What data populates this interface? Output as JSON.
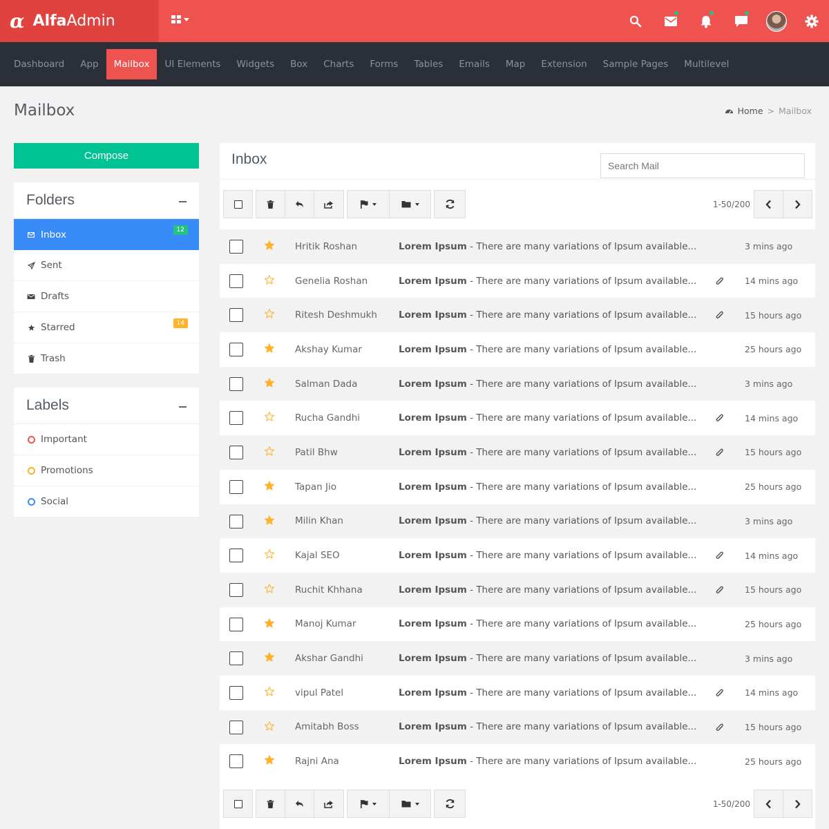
{
  "brand": {
    "part1": "Alfa",
    "part2": "Admin",
    "logo_icon": "alpha-logo"
  },
  "top_icons": [
    "search-icon",
    "mail-icon",
    "bell-icon",
    "chat-icon",
    "avatar",
    "gear-icon"
  ],
  "nav": [
    "Dashboard",
    "App",
    "Mailbox",
    "UI Elements",
    "Widgets",
    "Box",
    "Charts",
    "Forms",
    "Tables",
    "Emails",
    "Map",
    "Extension",
    "Sample Pages",
    "Multilevel"
  ],
  "nav_active": "Mailbox",
  "page": {
    "title": "Mailbox"
  },
  "breadcrumb": {
    "home": "Home",
    "sep": ">",
    "current": "Mailbox"
  },
  "compose": "Compose",
  "folders": {
    "title": "Folders",
    "items": [
      {
        "label": "Inbox",
        "icon": "envelope-icon",
        "badge": "12",
        "active": true
      },
      {
        "label": "Sent",
        "icon": "paper-plane-icon"
      },
      {
        "label": "Drafts",
        "icon": "drafts-icon"
      },
      {
        "label": "Starred",
        "icon": "star-icon",
        "badge": "14"
      },
      {
        "label": "Trash",
        "icon": "trash-icon"
      }
    ]
  },
  "labels": {
    "title": "Labels",
    "items": [
      {
        "label": "Important",
        "color": "#ef5350"
      },
      {
        "label": "Promotions",
        "color": "#ffb22b"
      },
      {
        "label": "Social",
        "color": "#398bf7"
      }
    ]
  },
  "inbox": {
    "title": "Inbox",
    "search_placeholder": "Search Mail"
  },
  "pager_text": "1-50/200",
  "colors": {
    "accent": "#ef5350",
    "compose": "#00c292",
    "active_folder": "#398bf7",
    "star": "#ffb22b",
    "navbar": "#2b3038"
  },
  "emails": [
    {
      "sender": "Hritik Roshan",
      "subject": "Lorem Ipsum",
      "preview": " - There are many variations of Ipsum available...",
      "time": "3 mins ago",
      "starred": true,
      "attachment": false
    },
    {
      "sender": "Genelia Roshan",
      "subject": "Lorem Ipsum",
      "preview": " - There are many variations of Ipsum available...",
      "time": "14 mins ago",
      "starred": false,
      "attachment": true
    },
    {
      "sender": "Ritesh Deshmukh",
      "subject": "Lorem Ipsum",
      "preview": " - There are many variations of Ipsum available...",
      "time": "15 hours ago",
      "starred": false,
      "attachment": true
    },
    {
      "sender": "Akshay Kumar",
      "subject": "Lorem Ipsum",
      "preview": " - There are many variations of Ipsum available...",
      "time": "25 hours ago",
      "starred": true,
      "attachment": false
    },
    {
      "sender": "Salman Dada",
      "subject": "Lorem Ipsum",
      "preview": " - There are many variations of Ipsum available...",
      "time": "3 mins ago",
      "starred": true,
      "attachment": false
    },
    {
      "sender": "Rucha Gandhi",
      "subject": "Lorem Ipsum",
      "preview": " - There are many variations of Ipsum available...",
      "time": "14 mins ago",
      "starred": false,
      "attachment": true
    },
    {
      "sender": "Patil Bhw",
      "subject": "Lorem Ipsum",
      "preview": " - There are many variations of Ipsum available...",
      "time": "15 hours ago",
      "starred": false,
      "attachment": true
    },
    {
      "sender": "Tapan Jio",
      "subject": "Lorem Ipsum",
      "preview": " - There are many variations of Ipsum available...",
      "time": "25 hours ago",
      "starred": true,
      "attachment": false
    },
    {
      "sender": "Milin Khan",
      "subject": "Lorem Ipsum",
      "preview": " - There are many variations of Ipsum available...",
      "time": "3 mins ago",
      "starred": true,
      "attachment": false
    },
    {
      "sender": "Kajal SEO",
      "subject": "Lorem Ipsum",
      "preview": " - There are many variations of Ipsum available...",
      "time": "14 mins ago",
      "starred": false,
      "attachment": true
    },
    {
      "sender": "Ruchit Khhana",
      "subject": "Lorem Ipsum",
      "preview": " - There are many variations of Ipsum available...",
      "time": "15 hours ago",
      "starred": false,
      "attachment": true
    },
    {
      "sender": "Manoj Kumar",
      "subject": "Lorem Ipsum",
      "preview": " - There are many variations of Ipsum available...",
      "time": "25 hours ago",
      "starred": true,
      "attachment": false
    },
    {
      "sender": "Akshar Gandhi",
      "subject": "Lorem Ipsum",
      "preview": " - There are many variations of Ipsum available...",
      "time": "3 mins ago",
      "starred": true,
      "attachment": false
    },
    {
      "sender": "vipul Patel",
      "subject": "Lorem Ipsum",
      "preview": " - There are many variations of Ipsum available...",
      "time": "14 mins ago",
      "starred": false,
      "attachment": true
    },
    {
      "sender": "Amitabh Boss",
      "subject": "Lorem Ipsum",
      "preview": " - There are many variations of Ipsum available...",
      "time": "15 hours ago",
      "starred": false,
      "attachment": true
    },
    {
      "sender": "Rajni Ana",
      "subject": "Lorem Ipsum",
      "preview": " - There are many variations of Ipsum available...",
      "time": "25 hours ago",
      "starred": true,
      "attachment": false
    }
  ]
}
